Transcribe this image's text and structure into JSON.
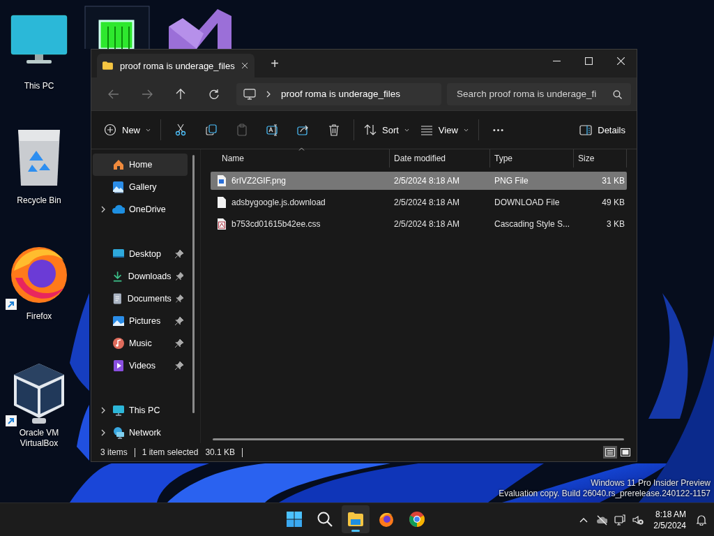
{
  "desktop": {
    "icons": [
      {
        "label": "This PC",
        "kind": "pc",
        "shortcut": false
      },
      {
        "label": "Recycle Bin",
        "kind": "bin",
        "shortcut": false
      },
      {
        "label": "Firefox",
        "kind": "firefox",
        "shortcut": true
      },
      {
        "label": "Oracle VM VirtualBox",
        "kind": "vbox",
        "shortcut": true
      }
    ],
    "partly_hidden_icons": [
      {
        "kind": "meter"
      },
      {
        "kind": "studio"
      }
    ],
    "watermark": [
      "Windows 11 Pro Insider Preview",
      "Evaluation copy. Build 26040.rs_prerelease.240122-1157"
    ]
  },
  "window": {
    "tabs": [
      {
        "title": "proof roma is underage_files",
        "selected": true
      }
    ],
    "new_tab": "+",
    "address": {
      "crumbs": [
        "proof roma is underage_files"
      ]
    },
    "search": {
      "placeholder": "Search proof roma is underage_fi"
    },
    "toolbar": {
      "groups": [
        [
          {
            "kind": "new",
            "label": "New",
            "dropdown": true,
            "disabled": false
          }
        ],
        [
          {
            "kind": "cut",
            "disabled": false
          },
          {
            "kind": "copy",
            "disabled": false
          },
          {
            "kind": "paste",
            "disabled": true
          },
          {
            "kind": "rename",
            "disabled": false
          },
          {
            "kind": "share",
            "disabled": false
          },
          {
            "kind": "delete",
            "disabled": false
          }
        ],
        [
          {
            "kind": "sort",
            "label": "Sort",
            "dropdown": true,
            "disabled": false
          },
          {
            "kind": "view",
            "label": "View",
            "dropdown": true,
            "disabled": false
          }
        ],
        [
          {
            "kind": "more",
            "disabled": false
          }
        ]
      ],
      "details": {
        "label": "Details"
      }
    },
    "nav": {
      "sections": [
        [
          {
            "label": "Home",
            "kind": "home",
            "selected": true
          },
          {
            "label": "Gallery",
            "kind": "gallery",
            "selected": false
          },
          {
            "label": "OneDrive",
            "kind": "onedrive",
            "selected": false,
            "expanded": false
          }
        ],
        [
          {
            "label": "Desktop",
            "kind": "desktop",
            "selected": false,
            "pinned": true
          },
          {
            "label": "Downloads",
            "kind": "downloads",
            "selected": false,
            "pinned": true
          },
          {
            "label": "Documents",
            "kind": "documents",
            "selected": false,
            "pinned": true
          },
          {
            "label": "Pictures",
            "kind": "pictures",
            "selected": false,
            "pinned": true
          },
          {
            "label": "Music",
            "kind": "music",
            "selected": false,
            "pinned": true
          },
          {
            "label": "Videos",
            "kind": "videos",
            "selected": false,
            "pinned": true
          }
        ],
        [
          {
            "label": "This PC",
            "kind": "pc",
            "selected": false,
            "expanded": false
          },
          {
            "label": "Network",
            "kind": "network",
            "selected": false,
            "expanded": false
          }
        ]
      ]
    },
    "table": {
      "columns": [
        {
          "label": "Name",
          "sorted": true
        },
        {
          "label": "Date modified",
          "sorted": false
        },
        {
          "label": "Type",
          "sorted": false
        },
        {
          "label": "Size",
          "sorted": false
        }
      ],
      "rows": [
        {
          "name": "6rIVZ2GIF.png",
          "date": "2/5/2024 8:18 AM",
          "type": "PNG File",
          "size": "31 KB",
          "kind": "image",
          "selected": true
        },
        {
          "name": "adsbygoogle.js.download",
          "date": "2/5/2024 8:18 AM",
          "type": "DOWNLOAD File",
          "size": "49 KB",
          "kind": "file",
          "selected": false
        },
        {
          "name": "b753cd01615b42ee.css",
          "date": "2/5/2024 8:18 AM",
          "type": "Cascading Style S...",
          "size": "3 KB",
          "kind": "css",
          "selected": false
        }
      ]
    },
    "status_bar": {
      "count": "3 items",
      "selection": "1 item selected",
      "selection_size": "30.1 KB",
      "views": [
        {
          "kind": "details",
          "selected": true
        },
        {
          "kind": "tiles",
          "selected": false
        }
      ]
    }
  },
  "taskbar": {
    "apps": [
      {
        "kind": "start",
        "active": false
      },
      {
        "kind": "search",
        "active": false
      },
      {
        "kind": "explorer",
        "active": true
      },
      {
        "kind": "firefox",
        "active": false
      },
      {
        "kind": "chrome",
        "active": false
      }
    ],
    "tray": {
      "time": "8:18 AM",
      "date": "2/5/2024"
    }
  }
}
